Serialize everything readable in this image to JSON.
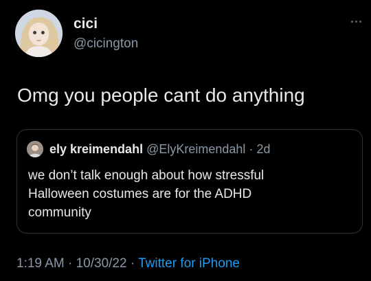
{
  "author": {
    "display_name": "cici",
    "handle": "@cicington",
    "avatar_icon": "doll-avatar"
  },
  "tweet": {
    "text": "Omg you people cant do anything"
  },
  "quoted_tweet": {
    "display_name": "ely kreimendahl",
    "handle": "@ElyKreimendahl",
    "separator": "·",
    "age": "2d",
    "text_lines": [
      "we don’t talk enough about how stressful",
      "Halloween costumes are for the ADHD",
      "community"
    ]
  },
  "meta": {
    "time": "1:19 AM",
    "separator1": " · ",
    "date": "10/30/22",
    "separator2": " · ",
    "source": "Twitter for iPhone"
  },
  "colors": {
    "background": "#000000",
    "text": "#e7e9ea",
    "secondary": "#8b98a5",
    "link": "#1d9bf0",
    "border": "#2f3336"
  }
}
